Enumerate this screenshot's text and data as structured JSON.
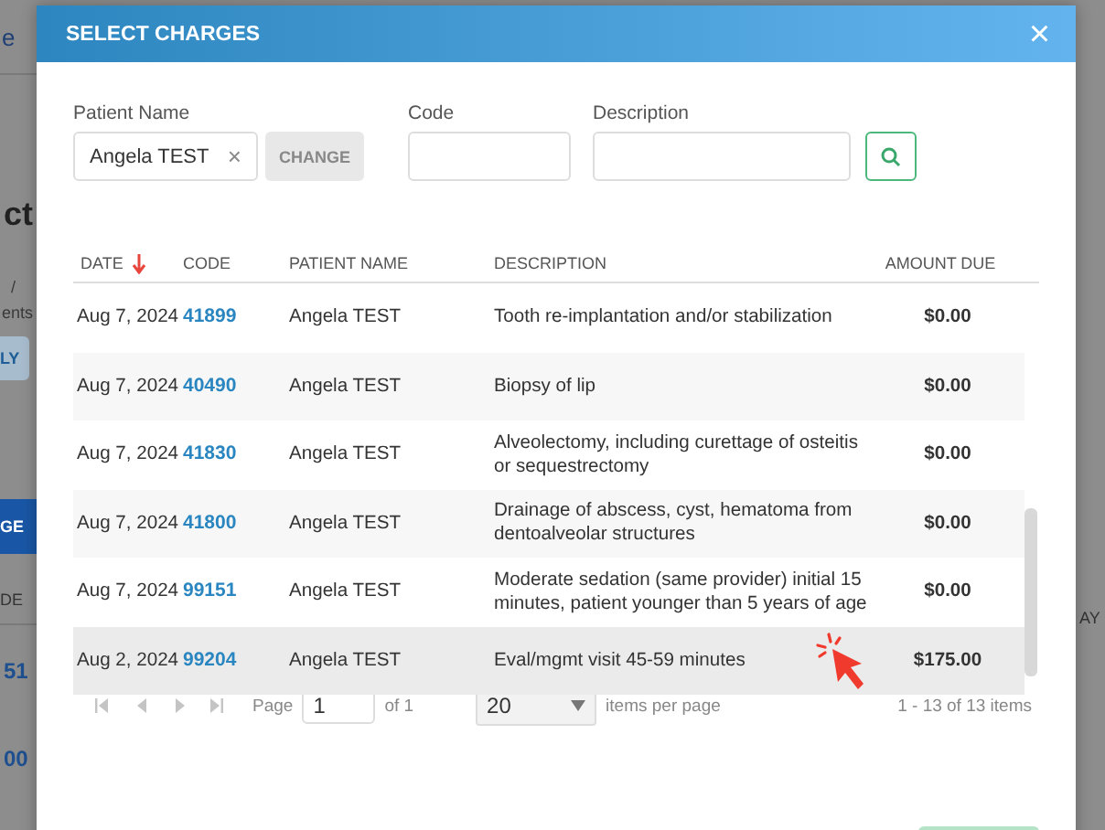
{
  "background": {
    "link": "e",
    "heading": "ct",
    "label_lines": [
      "/",
      "ents"
    ],
    "apply_button": "LY",
    "primary_button": "GE",
    "column_left": "DE",
    "codes": [
      "51",
      "00"
    ],
    "column_right": "AY"
  },
  "dialog": {
    "title": "SELECT CHARGES",
    "close": "×",
    "filters": {
      "patient": {
        "label": "Patient Name",
        "value": "Angela TEST",
        "clear": "×",
        "change_button": "CHANGE"
      },
      "code": {
        "label": "Code"
      },
      "description": {
        "label": "Description"
      }
    },
    "table": {
      "columns": [
        {
          "label": "DATE",
          "sorted": true
        },
        {
          "label": "CODE",
          "sorted": false
        },
        {
          "label": "PATIENT NAME",
          "sorted": false
        },
        {
          "label": "DESCRIPTION",
          "sorted": false
        },
        {
          "label": "AMOUNT DUE",
          "sorted": false
        }
      ],
      "rows": [
        {
          "date": "Aug 7, 2024",
          "code": "41899",
          "patient": "Angela TEST",
          "description": "Tooth re-implantation and/or stabilization",
          "amount": "$0.00",
          "hovered": false
        },
        {
          "date": "Aug 7, 2024",
          "code": "40490",
          "patient": "Angela TEST",
          "description": "Biopsy of lip",
          "amount": "$0.00",
          "hovered": false
        },
        {
          "date": "Aug 7, 2024",
          "code": "41830",
          "patient": "Angela TEST",
          "description": "Alveolectomy, including curettage of osteitis or sequestrectomy",
          "amount": "$0.00",
          "hovered": false
        },
        {
          "date": "Aug 7, 2024",
          "code": "41800",
          "patient": "Angela TEST",
          "description": "Drainage of abscess, cyst, hematoma from dentoalveolar structures",
          "amount": "$0.00",
          "hovered": false
        },
        {
          "date": "Aug 7, 2024",
          "code": "99151",
          "patient": "Angela TEST",
          "description": "Moderate sedation (same provider) initial 15 minutes, patient younger than 5 years of age",
          "amount": "$0.00",
          "hovered": false
        },
        {
          "date": "Aug 2, 2024",
          "code": "99204",
          "patient": "Angela TEST",
          "description": "Eval/mgmt visit 45-59 minutes",
          "amount": "$175.00",
          "hovered": true
        }
      ]
    },
    "pager": {
      "page_label": "Page",
      "page": "1",
      "of": "of 1",
      "per_page": "20",
      "per_page_label": "items per page",
      "summary": "1 - 13 of 13 items"
    }
  }
}
